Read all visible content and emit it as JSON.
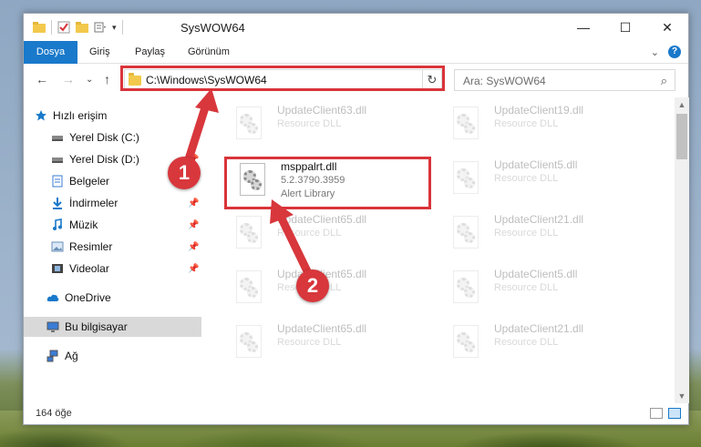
{
  "window": {
    "title": "SysWOW64",
    "controls": {
      "minimize": "—",
      "maximize": "☐",
      "close": "✕"
    }
  },
  "ribbon": {
    "tabs": [
      "Dosya",
      "Giriş",
      "Paylaş",
      "Görünüm"
    ],
    "help": "?",
    "expand": "⌄"
  },
  "navigation": {
    "back": "←",
    "forward": "→",
    "recent": "⌄",
    "up": "↑",
    "address": "C:\\Windows\\SysWOW64",
    "address_dropdown": "⌄",
    "refresh": "↻",
    "search_placeholder": "Ara: SysWOW64",
    "search_icon": "⌕"
  },
  "sidebar": {
    "items": [
      {
        "label": "Hızlı erişim",
        "icon": "star-icon",
        "pinned": false
      },
      {
        "label": "Yerel Disk (C:)",
        "icon": "drive-icon",
        "pinned": true
      },
      {
        "label": "Yerel Disk (D:)",
        "icon": "drive-icon",
        "pinned": true
      },
      {
        "label": "Belgeler",
        "icon": "documents-icon",
        "pinned": true
      },
      {
        "label": "İndirmeler",
        "icon": "downloads-icon",
        "pinned": true
      },
      {
        "label": "Müzik",
        "icon": "music-icon",
        "pinned": true
      },
      {
        "label": "Resimler",
        "icon": "pictures-icon",
        "pinned": true
      },
      {
        "label": "Videolar",
        "icon": "videos-icon",
        "pinned": true
      },
      {
        "label": "OneDrive",
        "icon": "cloud-icon",
        "pinned": false
      },
      {
        "label": "Bu bilgisayar",
        "icon": "computer-icon",
        "pinned": false
      },
      {
        "label": "Ağ",
        "icon": "network-icon",
        "pinned": false
      }
    ],
    "pin_glyph": "📌"
  },
  "files": {
    "highlighted": {
      "name": "msppalrt.dll",
      "version": "5.2.3790.3959",
      "description": "Alert Library"
    },
    "background": [
      {
        "name": "UpdateClient63.dll",
        "description": "Resource DLL"
      },
      {
        "name": "UpdateClient19.dll",
        "description": "Resource DLL"
      },
      {
        "name": "UpdateClient5.dll",
        "description": "Resource DLL"
      },
      {
        "name": "UpdateClient65.dll",
        "description": "Resource DLL"
      },
      {
        "name": "UpdateClient21.dll",
        "description": "Resource DLL"
      },
      {
        "name": "UpdateClient65.dll",
        "description": "Resource DLL"
      },
      {
        "name": "UpdateClient5.dll",
        "description": "Resource DLL"
      },
      {
        "name": "UpdateClient65.dll",
        "description": "Resource DLL"
      },
      {
        "name": "UpdateClient21.dll",
        "description": "Resource DLL"
      }
    ]
  },
  "status": {
    "item_count": "164 öğe"
  },
  "callouts": {
    "one": "1",
    "two": "2"
  },
  "colors": {
    "accent": "#1979ca",
    "highlight_red": "#d9343a"
  }
}
